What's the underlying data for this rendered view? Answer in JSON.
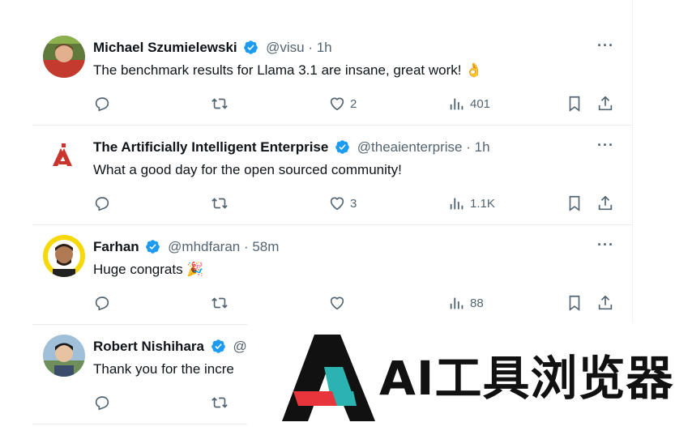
{
  "tweets": [
    {
      "name": "Michael Szumielewski",
      "handle": "@visu",
      "time": "· 1h",
      "text": "The benchmark results for Llama 3.1 are insane, great work! 👌",
      "likes": "2",
      "views": "401",
      "avatar": "avatar-photo-man-green"
    },
    {
      "name": "The Artificially Intelligent Enterprise",
      "handle": "@theaienterprise",
      "time": "· 1h",
      "text": "What a good day for the open sourced community!",
      "likes": "3",
      "views": "1.1K",
      "avatar": "red-triangle-logo"
    },
    {
      "name": "Farhan",
      "handle": "@mhdfaran",
      "time": "· 58m",
      "text": "Huge congrats 🎉",
      "likes": "",
      "views": "88",
      "avatar": "avatar-photo-man-yellow"
    },
    {
      "name": "Robert Nishihara",
      "handle": "@",
      "time": "",
      "text": "Thank you for the incre",
      "avatar": "avatar-photo-man-outdoor"
    }
  ],
  "more_label": "···",
  "watermark": {
    "text": "AI工具浏览器"
  },
  "colors": {
    "verified": "#1d9bf0",
    "secondary_text": "#536471",
    "wm_red": "#e8353c",
    "wm_teal": "#2ab3b1",
    "wm_dark": "#111111"
  }
}
